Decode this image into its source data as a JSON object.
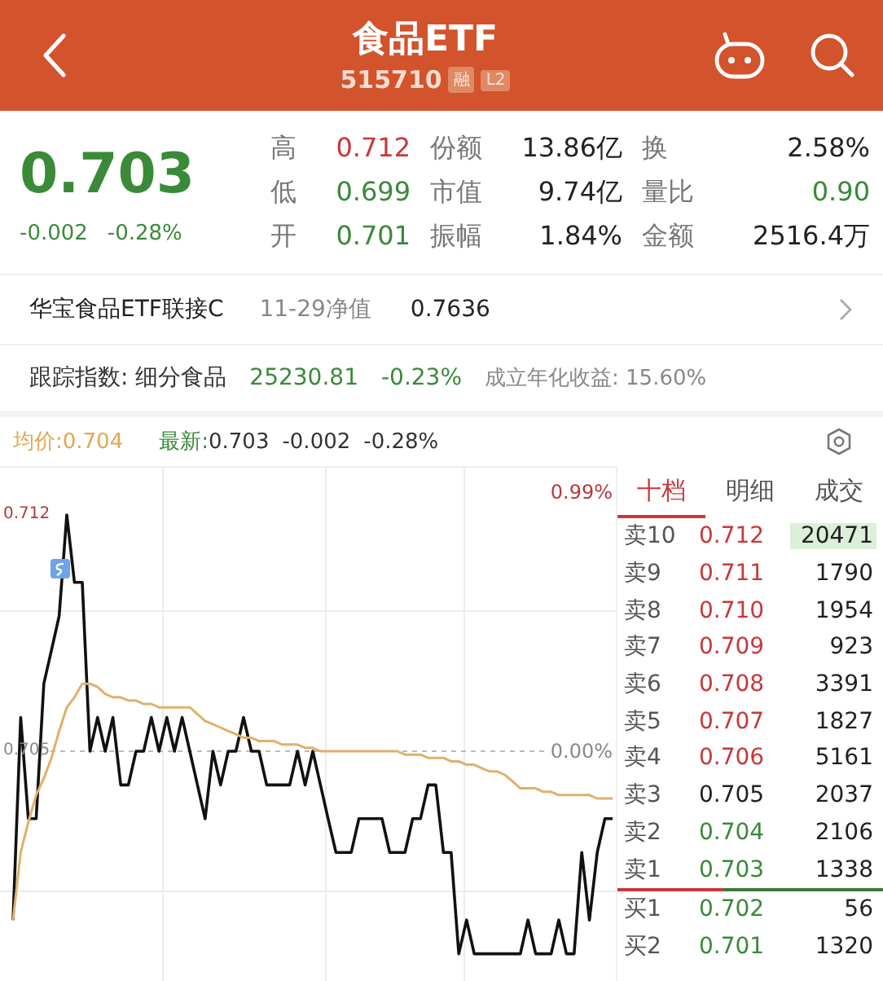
{
  "header": {
    "title": "食品ETF",
    "code": "515710",
    "badges": [
      "融",
      "L2"
    ]
  },
  "quote": {
    "price": "0.703",
    "change": "-0.002",
    "percent": "-0.28%",
    "color": "#3a8a3a"
  },
  "stats": [
    {
      "label": "高",
      "value": "0.712",
      "color": "#c8383a"
    },
    {
      "label": "份额",
      "value": "13.86亿",
      "color": "#222222"
    },
    {
      "label": "换",
      "value": "2.58%",
      "color": "#222222"
    },
    {
      "label": "低",
      "value": "0.699",
      "color": "#3a8a3a"
    },
    {
      "label": "市值",
      "value": "9.74亿",
      "color": "#222222"
    },
    {
      "label": "量比",
      "value": "0.90",
      "color": "#3a8a3a"
    },
    {
      "label": "开",
      "value": "0.701",
      "color": "#3a8a3a"
    },
    {
      "label": "振幅",
      "value": "1.84%",
      "color": "#222222"
    },
    {
      "label": "金额",
      "value": "2516.4万",
      "color": "#222222"
    }
  ],
  "fund_link": {
    "name": "华宝食品ETF联接C",
    "nav_label": "11-29净值",
    "nav": "0.7636"
  },
  "index_row": {
    "label": "跟踪指数: 细分食品",
    "value": "25230.81",
    "change": "-0.23%",
    "annual": "成立年化收益: 15.60%"
  },
  "chart_legend": {
    "avg": "均价:0.704",
    "latest_label": "最新:",
    "latest": "0.703",
    "change": "-0.002",
    "percent": "-0.28%"
  },
  "chart": {
    "high_percent": "0.99%",
    "base_percent": "0.00%",
    "chart_data": {
      "type": "line",
      "ylim": [
        0.698,
        0.7134
      ],
      "ref_lines": [
        {
          "axis": "y",
          "value": 0.705
        }
      ],
      "yticks": [
        {
          "value": 0.712,
          "label": "0.712"
        },
        {
          "value": 0.705,
          "label": "0.705"
        }
      ],
      "categories": [
        null,
        null,
        null,
        null,
        null,
        null,
        null,
        null,
        null,
        null,
        null,
        null,
        null,
        null,
        null,
        null,
        null,
        null,
        null,
        null,
        null,
        null,
        null,
        null,
        null,
        null,
        null,
        null,
        null,
        null,
        null,
        null,
        null,
        null,
        null,
        null,
        null,
        null,
        null,
        null,
        null,
        null,
        null,
        null,
        null,
        null,
        null,
        null,
        null,
        null,
        null,
        null,
        null,
        null,
        null,
        null,
        null,
        null,
        null,
        null,
        null,
        null,
        null,
        null,
        null,
        null,
        null,
        null,
        null,
        null,
        null,
        null,
        null,
        null,
        null,
        null,
        null,
        null,
        null
      ],
      "series": [
        {
          "color": "#111111",
          "values": [
            0.7,
            0.706,
            0.703,
            0.703,
            0.707,
            0.708,
            0.709,
            0.712,
            0.71,
            0.71,
            0.705,
            0.706,
            0.705,
            0.706,
            0.704,
            0.704,
            0.705,
            0.705,
            0.706,
            0.705,
            0.706,
            0.705,
            0.706,
            0.705,
            0.704,
            0.703,
            0.705,
            0.704,
            0.705,
            0.705,
            0.706,
            0.705,
            0.705,
            0.704,
            0.704,
            0.704,
            0.704,
            0.705,
            0.704,
            0.705,
            0.704,
            0.703,
            0.702,
            0.702,
            0.702,
            0.703,
            0.703,
            0.703,
            0.703,
            0.702,
            0.702,
            0.702,
            0.703,
            0.703,
            0.704,
            0.704,
            0.702,
            0.702,
            0.699,
            0.7,
            0.699,
            0.699,
            0.699,
            0.699,
            0.699,
            0.699,
            0.699,
            0.7,
            0.699,
            0.699,
            0.699,
            0.7,
            0.699,
            0.699,
            0.702,
            0.7,
            0.702,
            0.703,
            0.703
          ]
        },
        {
          "color": "#e0b06a",
          "values": [
            0.7,
            0.702,
            0.7029,
            0.7037,
            0.7042,
            0.7048,
            0.7056,
            0.7063,
            0.7066,
            0.707,
            0.707,
            0.7069,
            0.7067,
            0.7066,
            0.7066,
            0.7065,
            0.7065,
            0.7064,
            0.7064,
            0.7063,
            0.7063,
            0.7063,
            0.7063,
            0.7063,
            0.7061,
            0.7059,
            0.7058,
            0.7057,
            0.7056,
            0.7055,
            0.7054,
            0.7054,
            0.7053,
            0.7053,
            0.7053,
            0.7052,
            0.7052,
            0.7052,
            0.7051,
            0.7051,
            0.705,
            0.705,
            0.705,
            0.705,
            0.705,
            0.705,
            0.705,
            0.705,
            0.705,
            0.705,
            0.705,
            0.7049,
            0.7049,
            0.7049,
            0.7048,
            0.7048,
            0.7048,
            0.7047,
            0.7047,
            0.7046,
            0.7046,
            0.7045,
            0.7044,
            0.7044,
            0.7043,
            0.7041,
            0.7039,
            0.7039,
            0.7039,
            0.7038,
            0.7038,
            0.7037,
            0.7037,
            0.7037,
            0.7037,
            0.7037,
            0.7036,
            0.7036,
            0.7036
          ]
        }
      ]
    }
  },
  "order_book": {
    "tabs": [
      {
        "label": "十档",
        "selected": true
      },
      {
        "label": "明细",
        "selected": false
      },
      {
        "label": "成交",
        "selected": false
      }
    ],
    "asks": [
      {
        "label": "卖10",
        "price": "0.712",
        "volume": "20471",
        "color": "#c8383a",
        "highlighted": true
      },
      {
        "label": "卖9",
        "price": "0.711",
        "volume": "1790",
        "color": "#c8383a",
        "highlighted": false
      },
      {
        "label": "卖8",
        "price": "0.710",
        "volume": "1954",
        "color": "#c8383a",
        "highlighted": false
      },
      {
        "label": "卖7",
        "price": "0.709",
        "volume": "923",
        "color": "#c8383a",
        "highlighted": false
      },
      {
        "label": "卖6",
        "price": "0.708",
        "volume": "3391",
        "color": "#c8383a",
        "highlighted": false
      },
      {
        "label": "卖5",
        "price": "0.707",
        "volume": "1827",
        "color": "#c8383a",
        "highlighted": false
      },
      {
        "label": "卖4",
        "price": "0.706",
        "volume": "5161",
        "color": "#c8383a",
        "highlighted": false
      },
      {
        "label": "卖3",
        "price": "0.705",
        "volume": "2037",
        "color": "#222222",
        "highlighted": false
      },
      {
        "label": "卖2",
        "price": "0.704",
        "volume": "2106",
        "color": "#3a8a3a",
        "highlighted": false
      },
      {
        "label": "卖1",
        "price": "0.703",
        "volume": "1338",
        "color": "#3a8a3a",
        "highlighted": false
      }
    ],
    "bids": [
      {
        "label": "买1",
        "price": "0.702",
        "volume": "56",
        "color": "#3a8a3a",
        "highlighted": false
      },
      {
        "label": "买2",
        "price": "0.701",
        "volume": "1320",
        "color": "#3a8a3a",
        "highlighted": false
      }
    ]
  }
}
